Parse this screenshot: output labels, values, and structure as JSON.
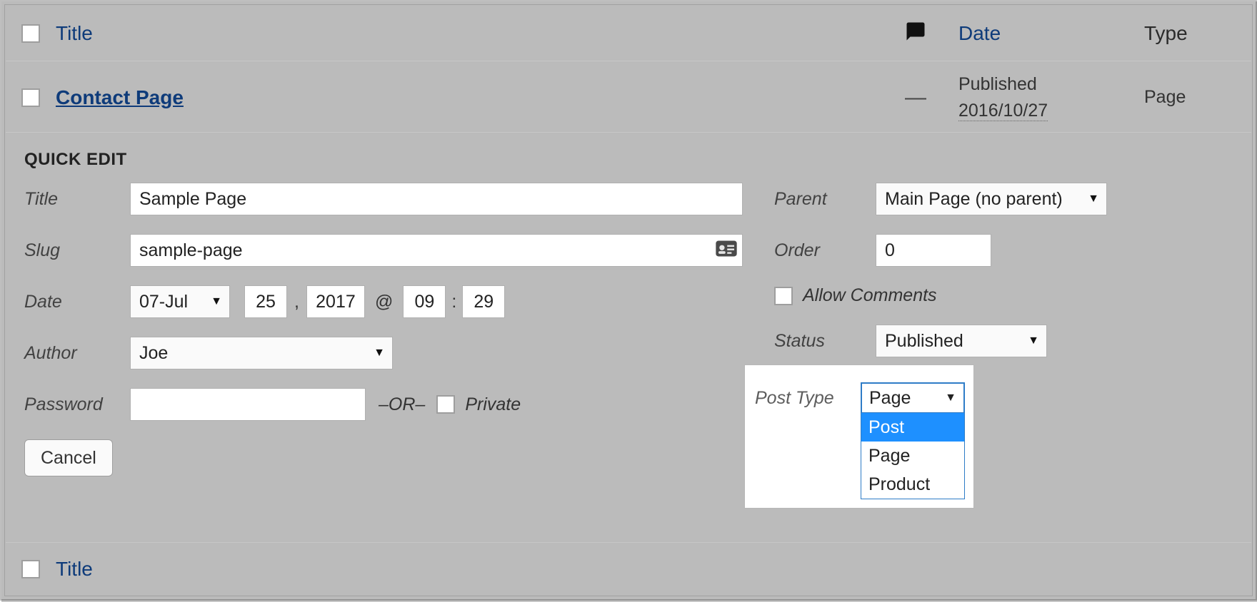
{
  "header": {
    "title": "Title",
    "date": "Date",
    "type": "Type"
  },
  "row": {
    "title": "Contact Page",
    "comments": "—",
    "status": "Published",
    "date": "2016/10/27",
    "type": "Page"
  },
  "footer": {
    "title": "Title"
  },
  "quick": {
    "heading": "QUICK EDIT",
    "left": {
      "title_label": "Title",
      "title_value": "Sample Page",
      "slug_label": "Slug",
      "slug_value": "sample-page",
      "date_label": "Date",
      "month": "07-Jul",
      "day": "25",
      "comma": ",",
      "year": "2017",
      "at": "@",
      "hour": "09",
      "colon": ":",
      "minute": "29",
      "author_label": "Author",
      "author_value": "Joe",
      "password_label": "Password",
      "password_value": "",
      "or": "–OR–",
      "private_label": "Private"
    },
    "right": {
      "parent_label": "Parent",
      "parent_value": "Main Page (no parent)",
      "order_label": "Order",
      "order_value": "0",
      "allow_comments": "Allow Comments",
      "status_label": "Status",
      "status_value": "Published"
    },
    "cancel": "Cancel"
  },
  "post_type": {
    "label": "Post Type",
    "selected": "Page",
    "options": [
      "Post",
      "Page",
      "Product"
    ],
    "highlighted_index": 0
  }
}
